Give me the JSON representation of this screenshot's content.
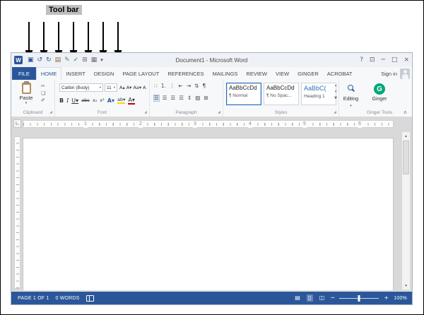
{
  "annotation": {
    "label": "Tool bar"
  },
  "window": {
    "logo_letter": "W",
    "title": "Document1 - Microsoft Word",
    "controls": {
      "help": "?",
      "ribbon_display": "⊡",
      "minimize": "─",
      "maximize": "□",
      "close": "×"
    }
  },
  "qat": {
    "icons": [
      {
        "name": "save",
        "glyph": "▣"
      },
      {
        "name": "undo",
        "glyph": "↺"
      },
      {
        "name": "redo",
        "glyph": "↻"
      },
      {
        "name": "open",
        "glyph": "▤"
      },
      {
        "name": "draw-table",
        "glyph": "✎"
      },
      {
        "name": "spelling-grammar",
        "glyph": "✓"
      },
      {
        "name": "borders",
        "glyph": "⊞"
      },
      {
        "name": "table",
        "glyph": "▦"
      },
      {
        "name": "customize",
        "glyph": "▾"
      }
    ]
  },
  "ribbon": {
    "tabs": [
      {
        "label": "FILE"
      },
      {
        "label": "HOME"
      },
      {
        "label": "INSERT"
      },
      {
        "label": "DESIGN"
      },
      {
        "label": "PAGE LAYOUT"
      },
      {
        "label": "REFERENCES"
      },
      {
        "label": "MAILINGS"
      },
      {
        "label": "REVIEW"
      },
      {
        "label": "VIEW"
      },
      {
        "label": "GINGER"
      },
      {
        "label": "ACROBAT"
      }
    ],
    "sign_in_label": "Sign in",
    "launcher_glyph": "◢",
    "collapse_glyph": "∧",
    "clipboard": {
      "paste_label": "Paste",
      "caret": "▾",
      "group_label": "Clipboard",
      "cut_glyph": "✂",
      "copy_glyph": "❏",
      "painter_glyph": "✐"
    },
    "font": {
      "name": "Calibri (Body)",
      "size": "11",
      "caret": "▾",
      "group_label": "Font",
      "row1": [
        "A▴",
        "A▾",
        "Aa▾",
        "A"
      ],
      "row2": [
        "B",
        "I",
        "U▾",
        "abc",
        "x₂",
        "x²",
        "A▾",
        "ab▾",
        "A▾"
      ]
    },
    "paragraph": {
      "group_label": "Paragraph",
      "row1": [
        "∷",
        "1.",
        "⋮",
        "⇤",
        "⇥",
        "⇅",
        "¶"
      ],
      "row2": [
        "☰",
        "☰",
        "☰",
        "☰",
        "⇕",
        "▨",
        "⊞"
      ]
    },
    "styles": {
      "group_label": "Styles",
      "items": [
        {
          "preview": "AaBbCcDd",
          "name": "¶ Normal"
        },
        {
          "preview": "AaBbCcDd",
          "name": "¶ No Spac..."
        },
        {
          "preview": "AaBbC(",
          "name": "Heading 1"
        }
      ],
      "scroll": [
        "▴",
        "▾",
        "▼"
      ]
    },
    "editing": {
      "label": "Editing",
      "caret": "▾"
    },
    "ginger": {
      "icon_letter": "G",
      "button_label": "Ginger",
      "group_label": "Ginger Tools"
    }
  },
  "ruler": {
    "tab_selector": "∟",
    "numbers": [
      "1",
      "2",
      "3",
      "4",
      "5",
      "6"
    ]
  },
  "scrollbar": {
    "up": "▴",
    "down": "▾"
  },
  "status_bar": {
    "page": "PAGE 1 OF 1",
    "words": "0 WORDS",
    "views": [
      {
        "name": "read-mode",
        "glyph": "▤"
      },
      {
        "name": "print-layout",
        "glyph": "▯"
      },
      {
        "name": "web-layout",
        "glyph": "◫"
      }
    ],
    "zoom_out": "─",
    "zoom_in": "+",
    "zoom_level": "100%"
  },
  "colors": {
    "accent": "#2b579a",
    "heading_blue": "#2e74b5",
    "ginger_green": "#00a878"
  }
}
